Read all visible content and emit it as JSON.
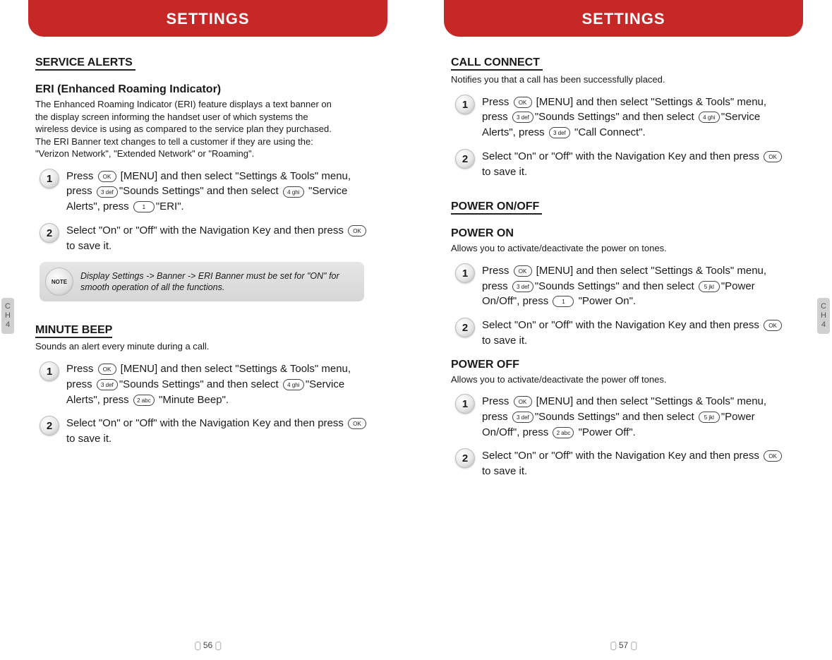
{
  "header": "SETTINGS",
  "chapter_tab": "CH4",
  "left_page": {
    "number": "56",
    "sections": [
      {
        "title": "SERVICE ALERTS",
        "subs": [
          {
            "title": "ERI (Enhanced Roaming Indicator)",
            "desc": "The Enhanced Roaming Indicator (ERI) feature displays a text banner on the display screen informing the handset user of which systems the wireless device is using as compared to the service plan they purchased. The ERI Banner text changes to tell a customer if they are using the: \"Verizon Network\", \"Extended Network\" or \"Roaming\".",
            "steps": [
              {
                "n": "1",
                "t1": "Press ",
                "t2": " [MENU] and then select \"Settings & Tools\" menu, press ",
                "t3": "\"Sounds Settings\" and then select ",
                "t4": " \"Service Alerts\", press ",
                "t5": "\"ERI\".",
                "keys": [
                  "OK",
                  "3 def",
                  "4 ghi",
                  "1"
                ]
              },
              {
                "n": "2",
                "t1": "Select \"On\" or \"Off\" with the Navigation Key and then press ",
                "t2": " to save it.",
                "keys": [
                  "OK"
                ]
              }
            ],
            "note": "Display Settings -> Banner -> ERI Banner must be set for \"ON\" for smooth operation of all the functions."
          },
          {
            "title": "MINUTE BEEP",
            "desc": "Sounds an alert every minute during a call.",
            "steps": [
              {
                "n": "1",
                "t1": "Press ",
                "t2": " [MENU] and then select \"Settings & Tools\" menu, press ",
                "t3": "\"Sounds Settings\" and then select ",
                "t4": "\"Service Alerts\", press ",
                "t5": " \"Minute Beep\".",
                "keys": [
                  "OK",
                  "3 def",
                  "4 ghi",
                  "2 abc"
                ]
              },
              {
                "n": "2",
                "t1": "Select \"On\" or \"Off\" with the Navigation Key and then press ",
                "t2": " to save it.",
                "keys": [
                  "OK"
                ]
              }
            ]
          }
        ]
      }
    ]
  },
  "right_page": {
    "number": "57",
    "sections": [
      {
        "title": "CALL CONNECT",
        "desc": "Notifies you that a call has been successfully placed.",
        "steps": [
          {
            "n": "1",
            "t1": "Press ",
            "t2": " [MENU] and then select \"Settings & Tools\" menu, press ",
            "t3": "\"Sounds Settings\" and then select ",
            "t4": "\"Service Alerts\", press ",
            "t5": " \"Call Connect\".",
            "keys": [
              "OK",
              "3 def",
              "4 ghi",
              "3 def"
            ]
          },
          {
            "n": "2",
            "t1": "Select \"On\" or \"Off\" with the Navigation Key and then press ",
            "t2": " to save it.",
            "keys": [
              "OK"
            ]
          }
        ]
      },
      {
        "title": "POWER ON/OFF",
        "subs": [
          {
            "title": "POWER ON",
            "desc": "Allows you to activate/deactivate the power on tones.",
            "steps": [
              {
                "n": "1",
                "t1": "Press ",
                "t2": " [MENU] and then select \"Settings & Tools\" menu, press ",
                "t3": "\"Sounds Settings\" and then select ",
                "t4": "\"Power On/Off\", press ",
                "t5": " \"Power On\".",
                "keys": [
                  "OK",
                  "3 def",
                  "5 jkl",
                  "1"
                ]
              },
              {
                "n": "2",
                "t1": "Select \"On\" or \"Off\" with the Navigation Key and then press ",
                "t2": " to save it.",
                "keys": [
                  "OK"
                ]
              }
            ]
          },
          {
            "title": "POWER OFF",
            "desc": "Allows you to activate/deactivate the power off tones.",
            "steps": [
              {
                "n": "1",
                "t1": "Press ",
                "t2": " [MENU] and then select \"Settings & Tools\" menu, press ",
                "t3": "\"Sounds Settings\" and then select ",
                "t4": "\"Power On/Off\", press ",
                "t5": " \"Power Off\".",
                "keys": [
                  "OK",
                  "3 def",
                  "5 jkl",
                  "2 abc"
                ]
              },
              {
                "n": "2",
                "t1": "Select \"On\" or \"Off\" with the Navigation Key and then press ",
                "t2": " to save it.",
                "keys": [
                  "OK"
                ]
              }
            ]
          }
        ]
      }
    ]
  },
  "note_label": "NOTE"
}
